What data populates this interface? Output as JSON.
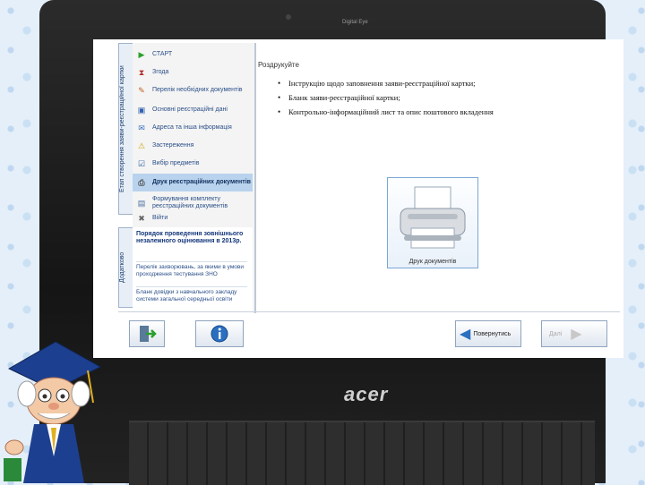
{
  "laptop": {
    "brand": "acer",
    "top_label": "Digital Eye"
  },
  "side_tabs": {
    "main": "Етап створення заяви-реєстраційної картки",
    "extra": "Додатково"
  },
  "sidebar": {
    "items": [
      {
        "label": "СТАРТ",
        "icon": "start-icon"
      },
      {
        "label": "Згода",
        "icon": "consent-icon"
      },
      {
        "label": "Перелік необхідних документів",
        "icon": "documents-icon"
      },
      {
        "label": "Основні реєстраційні дані",
        "icon": "registration-icon"
      },
      {
        "label": "Адреса та інша інформація",
        "icon": "address-icon"
      },
      {
        "label": "Застереження",
        "icon": "warning-icon"
      },
      {
        "label": "Вибір предметів",
        "icon": "subjects-icon"
      },
      {
        "label": "Друк реєстраційних документів",
        "icon": "print-icon"
      },
      {
        "label": "Формування комплекту реєстраційних документів",
        "icon": "package-icon"
      },
      {
        "label": "Війти",
        "icon": "exit-icon"
      }
    ],
    "active_index": 7
  },
  "info_panel": {
    "title": "Порядок проведення зовнішнього незалежного оцінювання в 2013р.",
    "links": [
      "Перелік захворювань, за якими в умови проходження тестування ЗНО",
      "Бланк довідки з навчального закладу системи загальної середньої освіти"
    ]
  },
  "main": {
    "title": "Роздрукуйте",
    "instructions": [
      "Інструкцію щодо заповнення заяви-реєстраційної картки;",
      "Бланк заяви-реєстраційної картки;",
      "Контрольно-інформаційний лист та опис поштового вкладення"
    ],
    "print_button_label": "Друк документів"
  },
  "buttons": {
    "back": "Повернутись",
    "next": "Далі"
  },
  "colors": {
    "accent": "#2b6fc0",
    "active_item_bg": "#b9d3ee"
  }
}
